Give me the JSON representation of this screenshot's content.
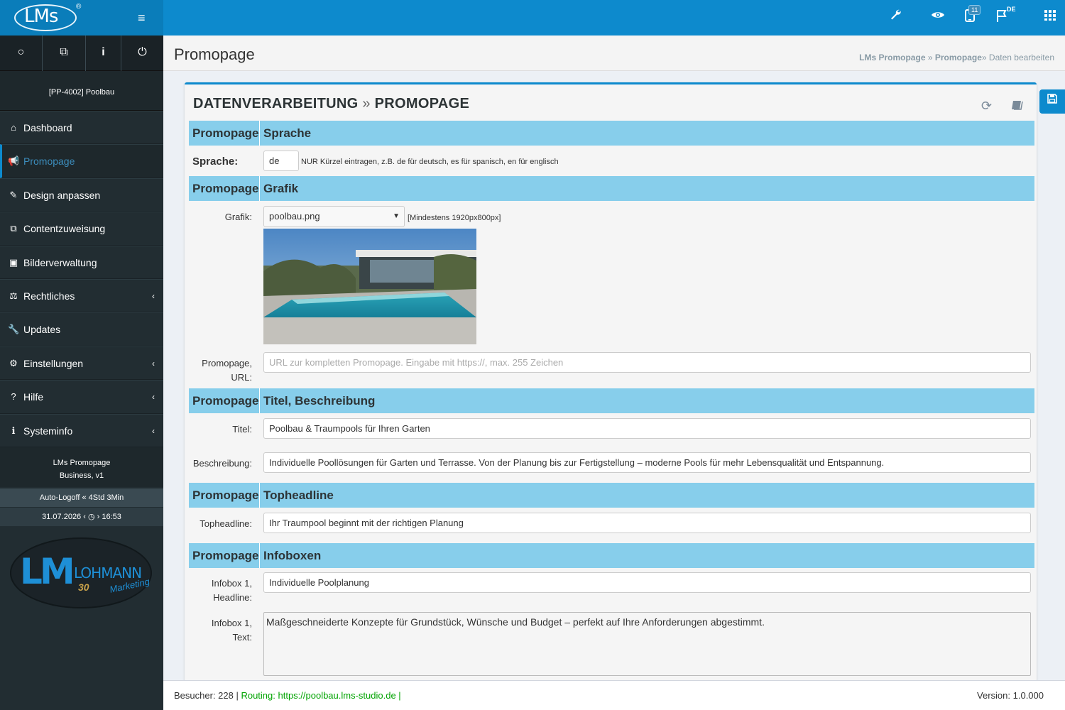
{
  "app": {
    "logo_text": "LMs",
    "logo_reg": "®"
  },
  "topbar": {
    "notifications_count": "11",
    "language": "DE"
  },
  "sidebar": {
    "client": "[PP-4002] Poolbau",
    "items": [
      {
        "label": "Dashboard",
        "icon": "home-icon",
        "glyph": "⌂",
        "chevron": ""
      },
      {
        "label": "Promopage",
        "icon": "megaphone-icon",
        "glyph": "📢",
        "chevron": ""
      },
      {
        "label": "Design anpassen",
        "icon": "edit-icon",
        "glyph": "✎",
        "chevron": ""
      },
      {
        "label": "Contentzuweisung",
        "icon": "external-link-icon",
        "glyph": "⧉",
        "chevron": ""
      },
      {
        "label": "Bilderverwaltung",
        "icon": "image-icon",
        "glyph": "▣",
        "chevron": ""
      },
      {
        "label": "Rechtliches",
        "icon": "gavel-icon",
        "glyph": "⚖",
        "chevron": "‹"
      },
      {
        "label": "Updates",
        "icon": "wrench-icon",
        "glyph": "🔧",
        "chevron": ""
      },
      {
        "label": "Einstellungen",
        "icon": "gears-icon",
        "glyph": "⚙",
        "chevron": "‹"
      },
      {
        "label": "Hilfe",
        "icon": "help-icon",
        "glyph": "?",
        "chevron": "‹"
      },
      {
        "label": "Systeminfo",
        "icon": "info-icon",
        "glyph": "ℹ",
        "chevron": "‹"
      }
    ],
    "version_line1": "LMs Promopage",
    "version_line2": "Business, v1",
    "logoff": "Auto-Logoff « 4Std 3Min",
    "datetime": "31.07.2026 ‹ ◷ › 16:53",
    "brand_lm": "LM",
    "brand_lohmann": "LOHMANN",
    "brand_30": "30",
    "brand_marketing": "Marketing"
  },
  "header": {
    "title": "Promopage",
    "crumb1": "LMs Promopage",
    "crumb2": "Promopage",
    "crumb3": "Daten bearbeiten",
    "sep": "»"
  },
  "panel": {
    "title_a": "DATENVERARBEITUNG",
    "title_sep": "»",
    "title_b": "PROMOPAGE"
  },
  "sections": {
    "s1": {
      "a": "Promopage",
      "b": "Sprache"
    },
    "s2": {
      "a": "Promopage",
      "b": "Grafik"
    },
    "s3": {
      "a": "Promopage",
      "b": "Titel, Beschreibung"
    },
    "s4": {
      "a": "Promopage",
      "b": "Topheadline"
    },
    "s5": {
      "a": "Promopage",
      "b": "Infoboxen"
    }
  },
  "fields": {
    "sprache_label": "Sprache:",
    "sprache_value": "de",
    "sprache_note": "NUR Kürzel eintragen, z.B. de für deutsch, es für spanisch, en für englisch",
    "grafik_label": "Grafik:",
    "grafik_value": "poolbau.png",
    "grafik_note": "[Mindestens 1920px800px]",
    "url_label_1": "Promopage,",
    "url_label_2": "URL:",
    "url_placeholder": "URL zur kompletten Promopage. Eingabe mit https://, max. 255 Zeichen",
    "titel_label": "Titel:",
    "titel_value": "Poolbau & Traumpools für Ihren Garten",
    "beschreibung_label": "Beschreibung:",
    "beschreibung_value": "Individuelle Poollösungen für Garten und Terrasse. Von der Planung bis zur Fertigstellung – moderne Pools für mehr Lebensqualität und Entspannung.",
    "topheadline_label": "Topheadline:",
    "topheadline_value": "Ihr Traumpool beginnt mit der richtigen Planung",
    "ib1_head_label_1": "Infobox 1,",
    "ib1_head_label_2": "Headline:",
    "ib1_head_value": "Individuelle Poolplanung",
    "ib1_text_label_1": "Infobox 1,",
    "ib1_text_label_2": "Text:",
    "ib1_text_value": "Maßgeschneiderte Konzepte für Grundstück, Wünsche und Budget – perfekt auf Ihre Anforderungen abgestimmt."
  },
  "footer": {
    "visitors": "Besucher: 228 |",
    "routing": "Routing: https://poolbau.lms-studio.de |",
    "version": "Version: 1.0.000"
  },
  "colors": {
    "primary": "#0d8acd",
    "sidebar": "#222d32",
    "section": "#87ceeb",
    "routing": "#00a300"
  }
}
